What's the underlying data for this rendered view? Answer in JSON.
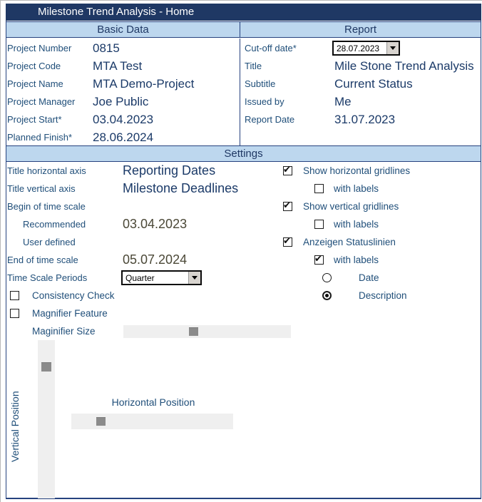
{
  "window": {
    "title": "Milestone Trend Analysis - Home"
  },
  "sections": {
    "basic_data": "Basic Data",
    "report": "Report",
    "settings": "Settings"
  },
  "colors": {
    "title_bar_bg": "#1F3864",
    "band_bg": "#BDD7EE",
    "border_navy": "#26427E",
    "label_text": "#1F4E79",
    "value_text": "#1B3A68",
    "computed_text": "#4B4837",
    "slider_track": "#EFEFEF",
    "slider_thumb": "#8B8B8B"
  },
  "basic_data": {
    "rows": [
      {
        "label": "Project Number",
        "value": "0815"
      },
      {
        "label": "Project Code",
        "value": "MTA Test"
      },
      {
        "label": "Project Name",
        "value": "MTA Demo-Project"
      },
      {
        "label": "Project Manager",
        "value": "Joe Public"
      },
      {
        "label": "Project Start*",
        "value": "03.04.2023"
      },
      {
        "label": "Planned Finish*",
        "value": "28.06.2024"
      }
    ]
  },
  "report": {
    "cutoff": {
      "label": "Cut-off date*",
      "value": "28.07.2023"
    },
    "rows": [
      {
        "label": "Title",
        "value": "Mile Stone Trend Analysis"
      },
      {
        "label": "Subtitle",
        "value": "Current Status"
      },
      {
        "label": "Issued by",
        "value": "Me"
      },
      {
        "label": "Report Date",
        "value": "31.07.2023"
      }
    ]
  },
  "settings": {
    "left": {
      "title_h_label": "Title horizontal axis",
      "title_h_value": "Reporting Dates",
      "title_v_label": "Title vertical axis",
      "title_v_value": "Milestone Deadlines",
      "begin_label": "Begin of time scale",
      "recommended_label": "Recommended",
      "recommended_value": "03.04.2023",
      "user_defined_label": "User defined",
      "end_label": "End of time scale",
      "end_value": "05.07.2024",
      "periods_label": "Time Scale Periods",
      "periods_value": "Quarter",
      "consistency": {
        "label": "Consistency Check",
        "checked": false
      },
      "magnifier": {
        "label": "Magnifier Feature",
        "checked": false
      },
      "magnifier_size_label": "Maginifier Size"
    },
    "right": {
      "h_grid": {
        "label": "Show horizontal gridlines",
        "checked": true
      },
      "h_grid_labels": {
        "label": "with labels",
        "checked": false
      },
      "v_grid": {
        "label": "Show vertical gridlines",
        "checked": true
      },
      "v_grid_labels": {
        "label": "with labels",
        "checked": false
      },
      "status_lines": {
        "label": "Anzeigen Statuslinien",
        "checked": true
      },
      "status_labels": {
        "label": "with labels",
        "checked": true
      },
      "date": {
        "label": "Date",
        "selected": false
      },
      "description": {
        "label": "Description",
        "selected": true
      }
    },
    "position": {
      "vertical_label": "Vertical Position",
      "horizontal_label": "Horizontal Position"
    }
  }
}
